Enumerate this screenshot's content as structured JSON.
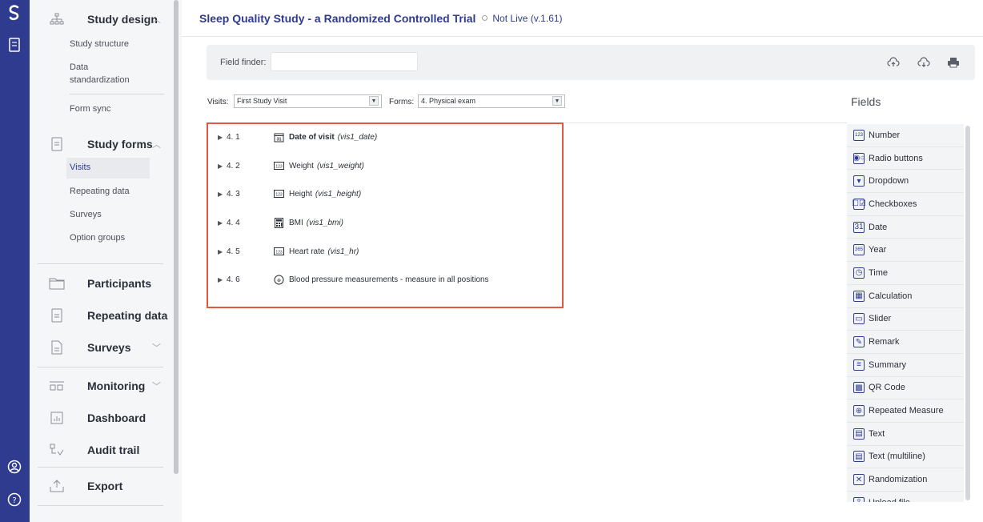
{
  "app": {
    "title": "Sleep Quality Study - a Randomized Controlled Trial",
    "status": "Not Live (v.1.61)"
  },
  "sidebar": {
    "sections": [
      {
        "label": "Study design",
        "chevron": "up",
        "icon": "hierarchy-icon"
      },
      {
        "label": "Study forms",
        "chevron": "up",
        "icon": "form-icon"
      },
      {
        "label": "Participants",
        "icon": "folder-icon"
      },
      {
        "label": "Repeating data",
        "icon": "repeating-icon"
      },
      {
        "label": "Surveys",
        "chevron": "down",
        "icon": "survey-icon"
      },
      {
        "label": "Monitoring",
        "chevron": "down",
        "icon": "monitoring-icon"
      },
      {
        "label": "Dashboard",
        "icon": "dashboard-icon"
      },
      {
        "label": "Audit trail",
        "icon": "audit-icon"
      },
      {
        "label": "Export",
        "icon": "export-icon"
      }
    ],
    "study_design_items": [
      "Study structure",
      "Data standardization",
      "Form sync"
    ],
    "study_forms_items": [
      "Visits",
      "Repeating data",
      "Surveys",
      "Option groups"
    ],
    "active_item": "Visits"
  },
  "finder": {
    "label": "Field finder:",
    "value": ""
  },
  "selectors": {
    "visits_label": "Visits:",
    "visits_value": "First Study Visit",
    "forms_label": "Forms:",
    "forms_value": "4. Physical exam"
  },
  "fields_heading": "Fields",
  "form_fields": [
    {
      "num": "4. 1",
      "icon": "date-icon",
      "name": "Date of visit",
      "var": "(vis1_date)",
      "bold": true
    },
    {
      "num": "4. 2",
      "icon": "number-icon",
      "name": "Weight",
      "var": "(vis1_weight)"
    },
    {
      "num": "4. 3",
      "icon": "number-icon",
      "name": "Height",
      "var": "(vis1_height)"
    },
    {
      "num": "4. 4",
      "icon": "calculator-icon",
      "name": "BMI",
      "var": "(vis1_bmi)"
    },
    {
      "num": "4. 5",
      "icon": "number-icon",
      "name": "Heart rate",
      "var": "(vis1_hr)"
    },
    {
      "num": "4. 6",
      "icon": "repeated-measure-icon",
      "name": "Blood pressure measurements - measure in all positions",
      "var": ""
    }
  ],
  "field_types": [
    {
      "label": "Number",
      "icon": "number-icon",
      "glyph": "123"
    },
    {
      "label": "Radio buttons",
      "icon": "radio-icon",
      "glyph": "◉○"
    },
    {
      "label": "Dropdown",
      "icon": "dropdown-icon",
      "glyph": "▾"
    },
    {
      "label": "Checkboxes",
      "icon": "checkbox-icon",
      "glyph": "☐☑"
    },
    {
      "label": "Date",
      "icon": "date-icon",
      "glyph": "31"
    },
    {
      "label": "Year",
      "icon": "year-icon",
      "glyph": "365"
    },
    {
      "label": "Time",
      "icon": "clock-icon",
      "glyph": "◷"
    },
    {
      "label": "Calculation",
      "icon": "calculator-icon",
      "glyph": "▦"
    },
    {
      "label": "Slider",
      "icon": "slider-icon",
      "glyph": "▭"
    },
    {
      "label": "Remark",
      "icon": "remark-icon",
      "glyph": "✎"
    },
    {
      "label": "Summary",
      "icon": "summary-icon",
      "glyph": "≡"
    },
    {
      "label": "QR Code",
      "icon": "qr-icon",
      "glyph": "▩"
    },
    {
      "label": "Repeated Measure",
      "icon": "repeated-measure-icon",
      "glyph": "⊕"
    },
    {
      "label": "Text",
      "icon": "text-icon",
      "glyph": "▤"
    },
    {
      "label": "Text (multiline)",
      "icon": "text-multiline-icon",
      "glyph": "▤"
    },
    {
      "label": "Randomization",
      "icon": "randomization-icon",
      "glyph": "✕"
    },
    {
      "label": "Upload file",
      "icon": "upload-icon",
      "glyph": "⇪"
    }
  ],
  "colors": {
    "rail": "#2f3b8f",
    "accent": "#2f3b8f",
    "highlight_border": "#e2573f"
  }
}
